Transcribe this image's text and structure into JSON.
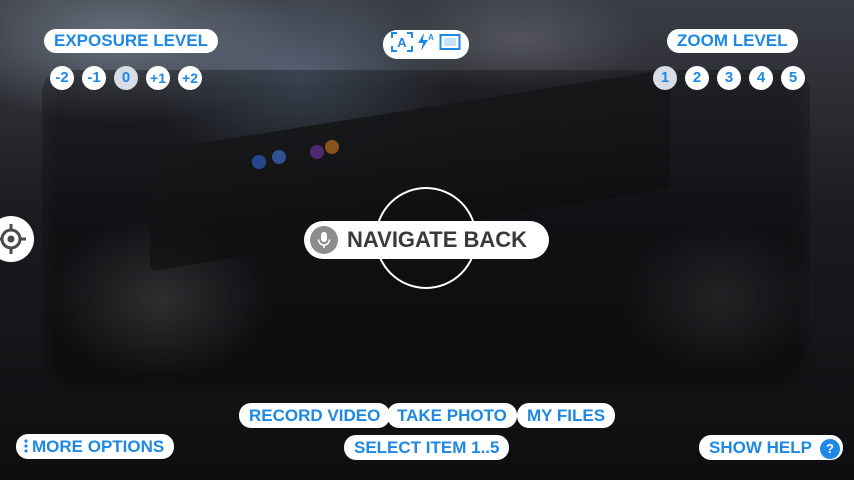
{
  "exposure": {
    "title": "EXPOSURE LEVEL",
    "levels": [
      "-2",
      "-1",
      "0",
      "+1",
      "+2"
    ],
    "selected": "0"
  },
  "zoom": {
    "title": "ZOOM LEVEL",
    "levels": [
      "1",
      "2",
      "3",
      "4",
      "5"
    ],
    "selected": "1"
  },
  "camera_modes": {
    "icons": [
      "auto-focus-icon",
      "auto-flash-icon",
      "aspect-ratio-icon"
    ],
    "flash_label": "A"
  },
  "voice": {
    "label": "NAVIGATE BACK",
    "icon": "microphone-icon"
  },
  "actions": {
    "record_video": "RECORD VIDEO",
    "take_photo": "TAKE PHOTO",
    "my_files": "MY FILES",
    "select_item": "SELECT ITEM 1..5",
    "more_options": "MORE OPTIONS",
    "show_help": "SHOW HELP",
    "help_icon": "?"
  },
  "colors": {
    "accent": "#1e88e5",
    "pill_bg": "#ffffff",
    "selected_bg": "#d6dde6"
  }
}
